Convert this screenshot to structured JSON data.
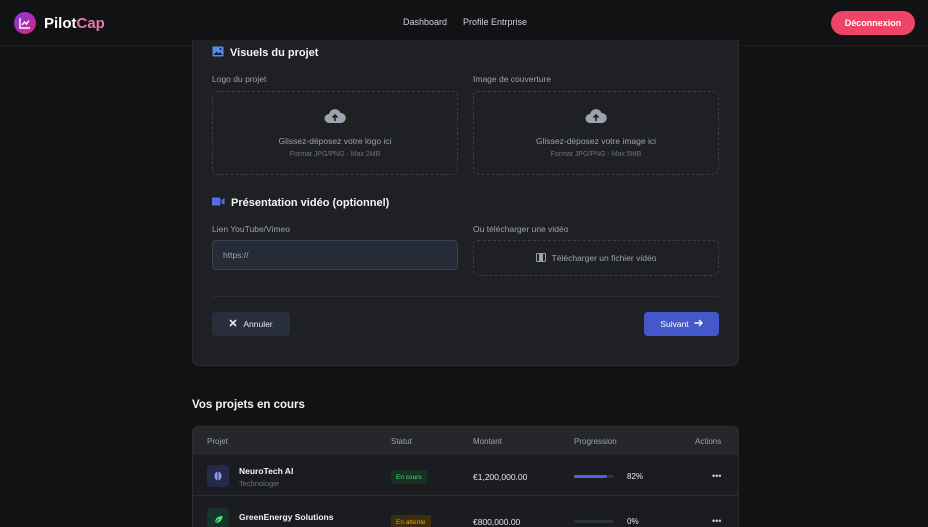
{
  "brand": {
    "name_main": "Pilot",
    "name_accent": "Cap"
  },
  "nav": {
    "links": [
      "Dashboard",
      "Profile Entrprise"
    ],
    "logout_label": "Déconnexion"
  },
  "form": {
    "visuals_title": "Visuels du projet",
    "logo_label": "Logo du projet",
    "logo_drop_text": "Glissez-déposez votre logo ici",
    "logo_format": "Format JPG/PNG - Max 2MB",
    "cover_label": "Image de couverture",
    "cover_drop_text": "Glissez-déposez votre image ici",
    "cover_format": "Format JPG/PNG - Max 5MB",
    "video_title": "Présentation vidéo (optionnel)",
    "link_label": "Lien YouTube/Vimeo",
    "link_value": "https://",
    "upload_label": "Ou télécharger une vidéo",
    "upload_button": "Télécharger un fichier vidéo",
    "cancel_label": "Annuler",
    "next_label": "Suivant"
  },
  "projects": {
    "title": "Vos projets en cours",
    "columns": [
      "Projet",
      "Statut",
      "Montant",
      "Progression",
      "Actions"
    ],
    "rows": [
      {
        "name": "NeuroTech AI",
        "category": "Technologie",
        "status": "En cours",
        "amount": "€1,200,000.00",
        "progress": 0.82,
        "progress_label": "82%",
        "actions": "•••"
      },
      {
        "name": "GreenEnergy Solutions",
        "category": "",
        "status": "En attente",
        "amount": "€800,000.00",
        "progress": 0,
        "progress_label": "0%",
        "actions": "•••"
      }
    ]
  },
  "colors": {
    "accent": "#4458c9",
    "logout": "#ef4467",
    "status_in_progress": "#4ade80",
    "status_pending": "#f59e0b"
  },
  "icons": {
    "brand": "chart-line-icon",
    "visuals": "image-icon",
    "upload": "cloud-upload-icon",
    "video": "video-camera-icon",
    "film": "film-icon",
    "cancel": "close-icon",
    "next": "arrow-right-icon"
  }
}
